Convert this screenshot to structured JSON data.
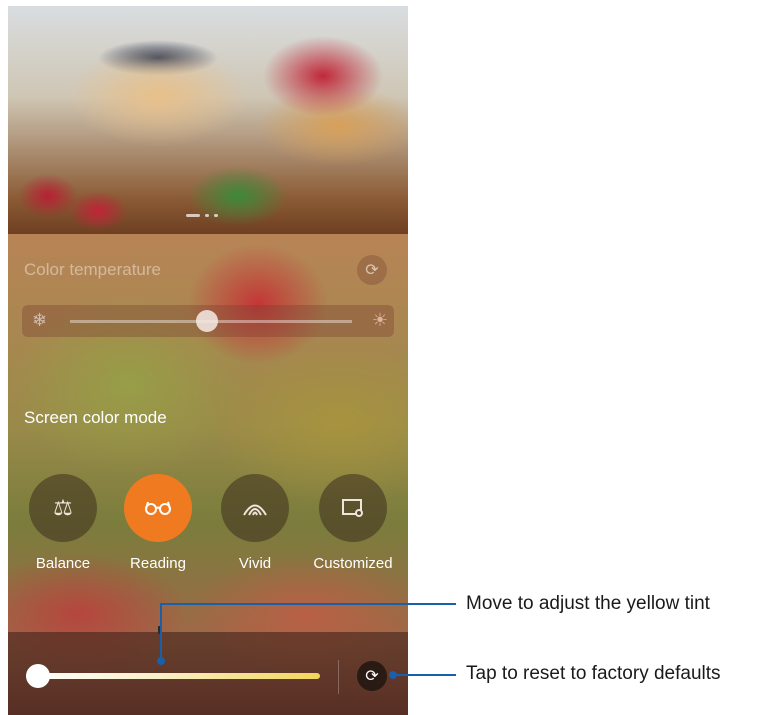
{
  "color_temperature": {
    "label": "Color temperature",
    "cold_icon": "snowflake-icon",
    "warm_icon": "sun-icon",
    "reset_icon": "refresh-icon",
    "level": 0.55
  },
  "screen_color_mode": {
    "title": "Screen color mode",
    "modes": [
      {
        "label": "Balance",
        "icon": "scale-icon",
        "active": false
      },
      {
        "label": "Reading",
        "icon": "glasses-icon",
        "active": true
      },
      {
        "label": "Vivid",
        "icon": "wave-icon",
        "active": false
      },
      {
        "label": "Customized",
        "icon": "custom-settings-icon",
        "active": false
      }
    ]
  },
  "tint_slider": {
    "level": 0.0,
    "reset_icon": "refresh-icon"
  },
  "annotations": {
    "slider": "Move to adjust the yellow tint",
    "reset": "Tap to reset to factory defaults"
  },
  "colors": {
    "accent": "#f07a20",
    "callout": "#1a5fa8"
  }
}
